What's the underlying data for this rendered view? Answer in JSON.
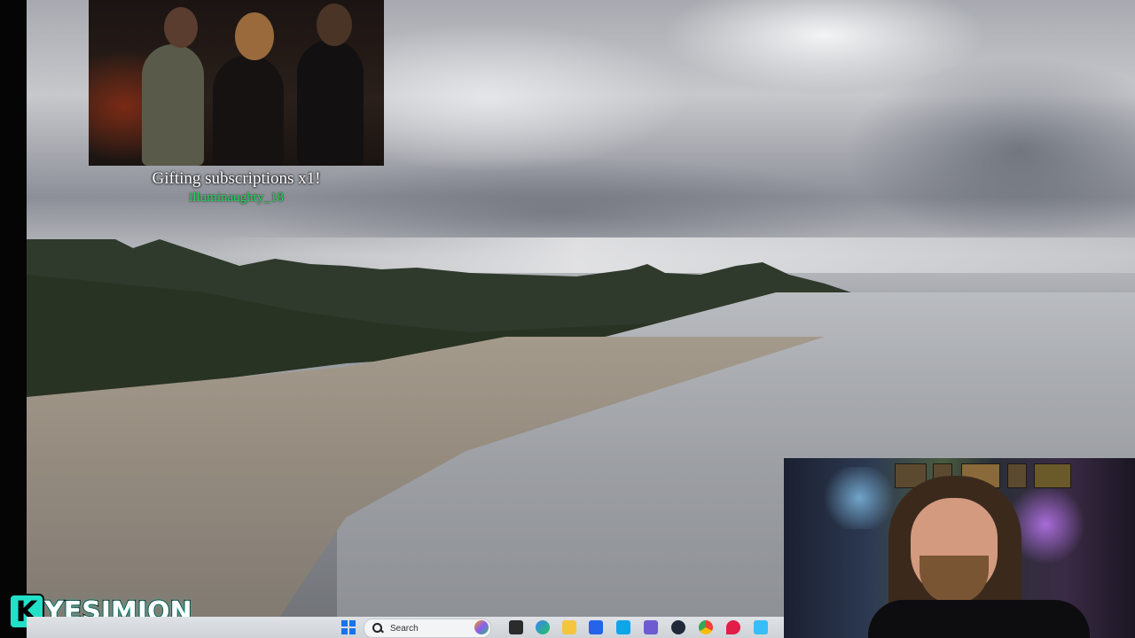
{
  "alert": {
    "title": "Gifting subscriptions x1!",
    "username": "illuminaughty_18"
  },
  "overlay": {
    "channel_logo_letter": "K",
    "channel_name": "YESIMJON"
  },
  "taskbar": {
    "search_label": "Search",
    "pinned_icons": [
      "copilot-icon",
      "task-view-icon",
      "edge-icon",
      "file-explorer-icon",
      "store-icon",
      "mail-icon",
      "teams-icon",
      "obs-icon",
      "chrome-icon",
      "maps-icon",
      "notepad-icon"
    ]
  },
  "colors": {
    "alert_username": "#22d85a",
    "logo_accent": "#22e0c8",
    "taskbar_bg": "#dfe2e6"
  }
}
